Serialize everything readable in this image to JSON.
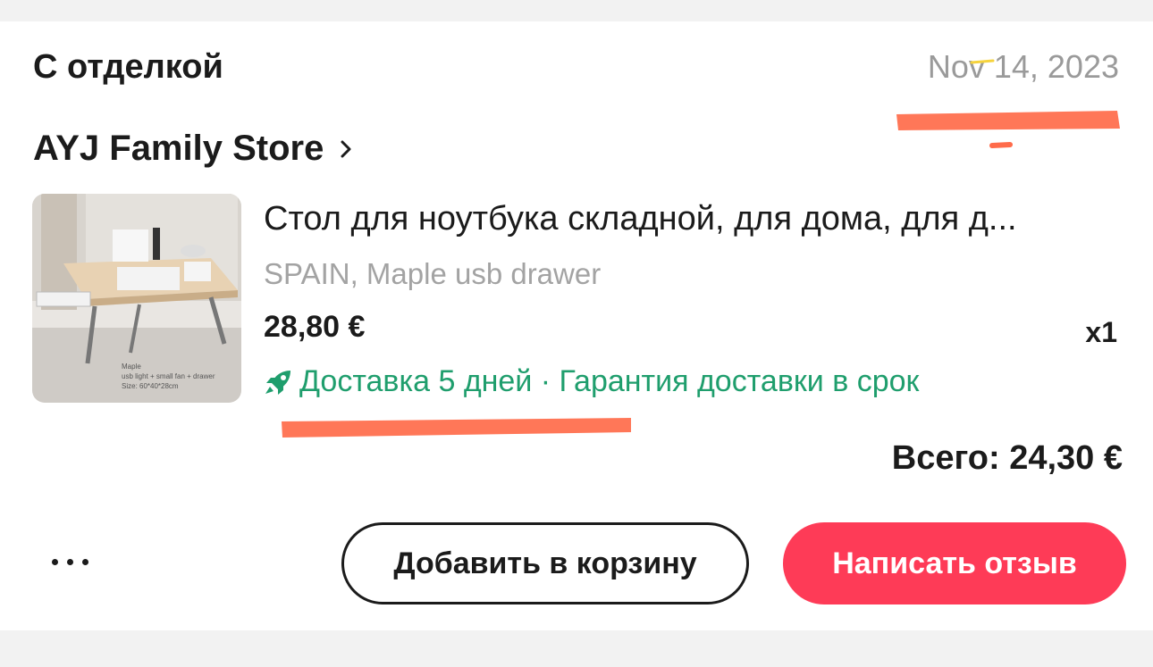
{
  "order": {
    "status": "С отделкой",
    "date": "Nov 14, 2023",
    "store_name": "AYJ Family Store",
    "product": {
      "title": "Стол для ноутбука складной, для дома, для д...",
      "variant": "SPAIN, Maple usb drawer",
      "price": "28,80 €",
      "quantity": "x1",
      "image_caption": [
        "Maple",
        "usb light + small fan + drawer",
        "Size: 60*40*28cm"
      ]
    },
    "delivery": "Доставка 5 дней · Гарантия доставки в срок",
    "total": "Всего: 24,30 €"
  },
  "actions": {
    "add_to_cart": "Добавить в корзину",
    "write_review": "Написать отзыв"
  },
  "colors": {
    "delivery_green": "#1f9e6d",
    "accent_red": "#fe3b57",
    "annotation_scribble": "#ff6b4a"
  },
  "icons": [
    "chevron-right-icon",
    "rocket-icon",
    "more-dots-icon"
  ]
}
